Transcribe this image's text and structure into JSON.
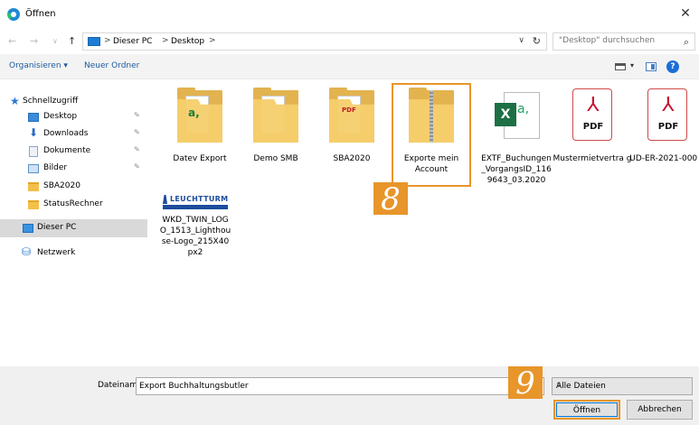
{
  "window": {
    "title": "Öffnen",
    "close": "✕"
  },
  "address": {
    "crumbs": [
      "Dieser PC",
      "Desktop"
    ],
    "separators": [
      ">",
      ">",
      ">"
    ],
    "search_placeholder": "\"Desktop\" durchsuchen"
  },
  "commands": {
    "organize": "Organisieren ▾",
    "new_folder": "Neuer Ordner",
    "help": "?"
  },
  "sidebar": {
    "items": [
      {
        "label": "Schnellzugriff",
        "icon": "star-icon"
      },
      {
        "label": "Desktop",
        "icon": "desktop-icon",
        "pinned": true
      },
      {
        "label": "Downloads",
        "icon": "download-icon",
        "pinned": true
      },
      {
        "label": "Dokumente",
        "icon": "documents-icon",
        "pinned": true
      },
      {
        "label": "Bilder",
        "icon": "pictures-icon",
        "pinned": true
      },
      {
        "label": "SBA2020",
        "icon": "folder-icon"
      },
      {
        "label": "StatusRechner",
        "icon": "folder-icon"
      },
      {
        "label": "Dieser PC",
        "icon": "pc-icon",
        "selected": true
      },
      {
        "label": "Netzwerk",
        "icon": "network-icon"
      }
    ]
  },
  "files": [
    {
      "label": "Datev Export",
      "kind": "folder-xls",
      "badge": "a,"
    },
    {
      "label": "Demo SMB",
      "kind": "folder-doc"
    },
    {
      "label": "SBA2020",
      "kind": "folder-pdf",
      "badge": "PDF"
    },
    {
      "label": "Exporte mein Account",
      "kind": "folder-zip",
      "selected": true
    },
    {
      "label": "EXTF_Buchungen _VorgangsID_116 9643_03.2020",
      "kind": "xls",
      "badge_x": "X",
      "badge_a": "a,"
    },
    {
      "label": "Mustermietvertra g",
      "kind": "pdf",
      "badge": "PDF"
    },
    {
      "label": "UD-ER-2021-000 9",
      "kind": "pdf",
      "badge": "PDF"
    },
    {
      "label": "WKD_TWIN_LOG O_1513_Lighthou se-Logo_215X40 px2",
      "kind": "image",
      "brand": "LEUCHTTURM"
    }
  ],
  "callouts": {
    "step8": "8",
    "step9": "9"
  },
  "bottom": {
    "filename_label": "Dateiname:",
    "filename_value": "Export Buchhaltungsbutler",
    "filetype": "Alle Dateien",
    "open": "Öffnen",
    "cancel": "Abbrechen"
  },
  "colors": {
    "accent": "#e8952a",
    "link": "#1b5a9e",
    "selection": "#d9d9d9"
  }
}
